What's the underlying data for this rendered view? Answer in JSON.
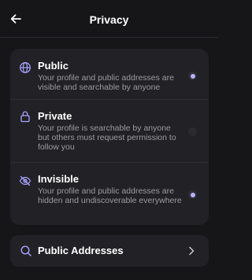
{
  "header": {
    "title": "Privacy",
    "back_icon": "arrow-left-icon"
  },
  "options": [
    {
      "title": "Public",
      "description": "Your profile and public addresses are visible and searchable by anyone",
      "icon": "globe-icon",
      "selected": true
    },
    {
      "title": "Private",
      "description": "Your profile is searchable by anyone but others must request permission to follow you",
      "icon": "lock-icon",
      "selected": false
    },
    {
      "title": "Invisible",
      "description": "Your profile and public addresses are hidden and undiscoverable everywhere",
      "icon": "eye-off-icon",
      "selected": false
    }
  ],
  "addresses": {
    "label": "Public Addresses",
    "icon": "search-icon",
    "chevron": "chevron-right-icon"
  },
  "colors": {
    "background": "#161618",
    "card": "#222226",
    "accent": "#b6b0ff",
    "icon_accent": "#a9a3ff",
    "secondary_text": "#9a9aa2"
  }
}
